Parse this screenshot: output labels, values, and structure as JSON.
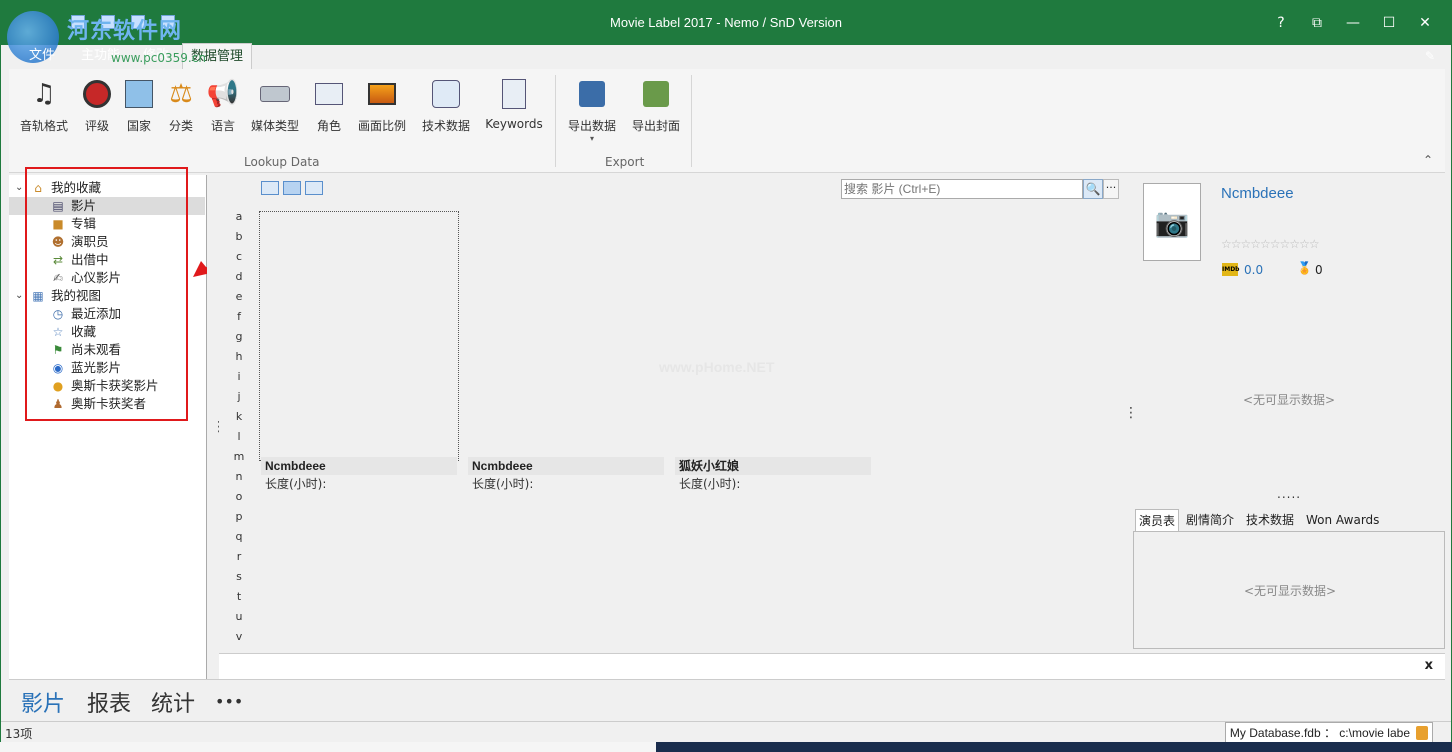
{
  "window": {
    "title": "Movie Label 2017 - Nemo / SnD Version",
    "controls": [
      "?",
      "⧉",
      "—",
      "☐",
      "✕"
    ]
  },
  "watermark": {
    "text": "河东软件网",
    "url": "www.pc0359.cn",
    "center": "www.pHome.NET"
  },
  "ribbon_tabs": [
    {
      "label": "文件"
    },
    {
      "label": "主功能"
    },
    {
      "label": "修改"
    },
    {
      "label": "数据管理"
    }
  ],
  "ribbon": {
    "lookup_items": [
      {
        "label": "音轨格式",
        "icon": "music-note-icon"
      },
      {
        "label": "评级",
        "icon": "rating-hand-icon"
      },
      {
        "label": "国家",
        "icon": "country-map-icon"
      },
      {
        "label": "分类",
        "icon": "scales-icon"
      },
      {
        "label": "语言",
        "icon": "megaphone-icon"
      },
      {
        "label": "媒体类型",
        "icon": "drive-icon"
      },
      {
        "label": "角色",
        "icon": "role-card-icon"
      },
      {
        "label": "画面比例",
        "icon": "aspect-ratio-icon"
      },
      {
        "label": "技术数据",
        "icon": "tech-data-icon"
      },
      {
        "label": "Keywords",
        "icon": "keywords-search-icon"
      }
    ],
    "lookup_group": "Lookup Data",
    "export_items": [
      {
        "label": "导出数据",
        "icon": "export-data-icon"
      },
      {
        "label": "导出封面",
        "icon": "export-cover-icon"
      }
    ],
    "export_group": "Export"
  },
  "tree": {
    "groups": [
      {
        "label": "我的收藏",
        "icon": "home-icon",
        "items": [
          {
            "label": "影片",
            "icon": "film-icon",
            "selected": true
          },
          {
            "label": "专辑",
            "icon": "box-icon"
          },
          {
            "label": "演职员",
            "icon": "people-icon"
          },
          {
            "label": "出借中",
            "icon": "lend-icon"
          },
          {
            "label": "心仪影片",
            "icon": "wish-icon"
          }
        ]
      },
      {
        "label": "我的视图",
        "icon": "views-icon",
        "items": [
          {
            "label": "最近添加",
            "icon": "clock-icon"
          },
          {
            "label": "收藏",
            "icon": "star-icon"
          },
          {
            "label": "尚未观看",
            "icon": "flag-icon"
          },
          {
            "label": "蓝光影片",
            "icon": "bluray-icon"
          },
          {
            "label": "奥斯卡获奖影片",
            "icon": "bulb-icon"
          },
          {
            "label": "奥斯卡获奖者",
            "icon": "winner-icon"
          }
        ]
      }
    ]
  },
  "search": {
    "placeholder": "搜索 影片 (Ctrl+E)"
  },
  "alphabet": [
    "a",
    "b",
    "c",
    "d",
    "e",
    "f",
    "g",
    "h",
    "i",
    "j",
    "k",
    "l",
    "m",
    "n",
    "o",
    "p",
    "q",
    "r",
    "s",
    "t",
    "u",
    "v"
  ],
  "cards": [
    {
      "title": "Ncmbdeee",
      "sub": "长度(小时):"
    },
    {
      "title": "Ncmbdeee",
      "sub": "长度(小时):"
    },
    {
      "title": "狐妖小红娘",
      "sub": "长度(小时):"
    }
  ],
  "details": {
    "title": "Ncmbdeee",
    "imdb_label": "IMDb",
    "imdb_rating": "0.0",
    "awards": "0",
    "no_data_top": "<无可显示数据>",
    "tabs": [
      "演员表",
      "剧情简介",
      "技术数据",
      "Won Awards"
    ],
    "no_data_bottom": "<无可显示数据>"
  },
  "footer_nav": [
    "影片",
    "报表",
    "统计",
    "•••"
  ],
  "status": {
    "count": "13项",
    "database": "My Database.fdb ： c:\\movie labe"
  },
  "colors": {
    "titlebar": "#1f7a3e",
    "accent": "#2a72b8",
    "highlight_box": "#e0191b"
  }
}
